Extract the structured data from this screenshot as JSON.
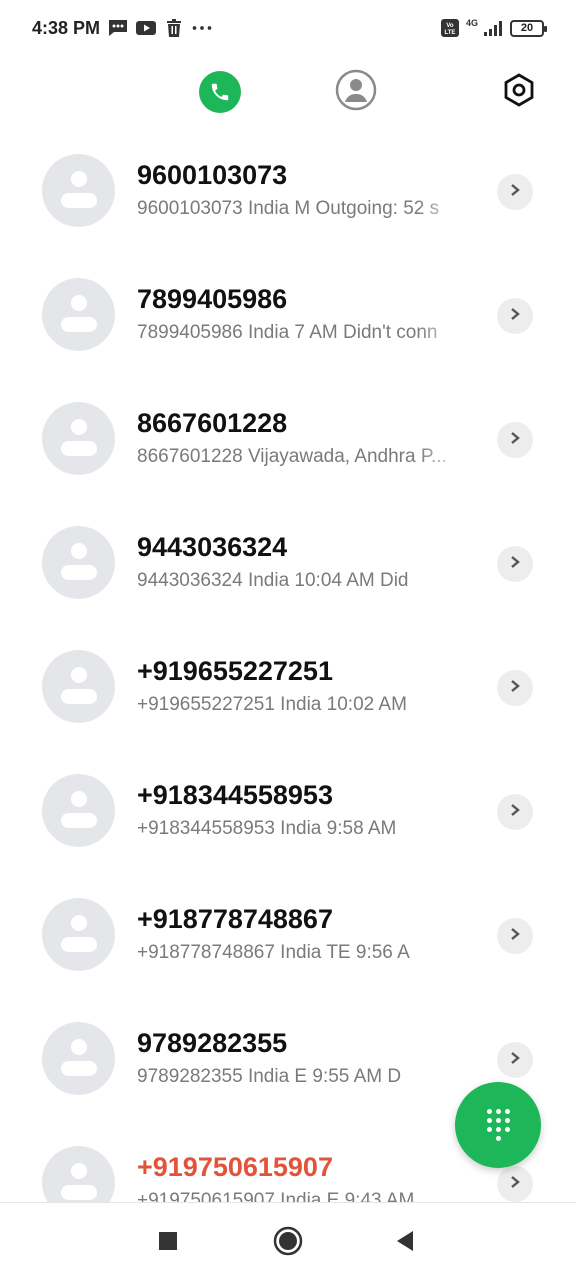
{
  "status_bar": {
    "time": "4:38 PM",
    "icons": [
      "message-icon",
      "youtube-icon",
      "trash-icon",
      "more-icon"
    ],
    "network": "4G",
    "battery": "20"
  },
  "top_tabs": [
    "phone-icon",
    "contacts-icon",
    "settings-icon"
  ],
  "accent_color": "#1db75a",
  "missed_color": "#e2533a",
  "calls": [
    {
      "name": "9600103073",
      "detail": "9600103073 India  M Outgoing: 52 s"
    },
    {
      "name": "7899405986",
      "detail": "7899405986 India  7 AM Didn't conn"
    },
    {
      "name": "8667601228",
      "detail": "8667601228 Vijayawada, Andhra P..."
    },
    {
      "name": "9443036324",
      "detail": "9443036324 India          10:04 AM Did"
    },
    {
      "name": "+919655227251",
      "detail": "+919655227251 India          10:02 AM"
    },
    {
      "name": "+918344558953",
      "detail": "+918344558953 India          9:58 AM"
    },
    {
      "name": "+918778748867",
      "detail": "+918778748867 India  TE         9:56 A"
    },
    {
      "name": "9789282355",
      "detail": "9789282355 India  E         9:55 AM D"
    },
    {
      "name": "+919750615907",
      "detail": "+919750615907 India  E        9:43 AM",
      "missed": true
    }
  ]
}
